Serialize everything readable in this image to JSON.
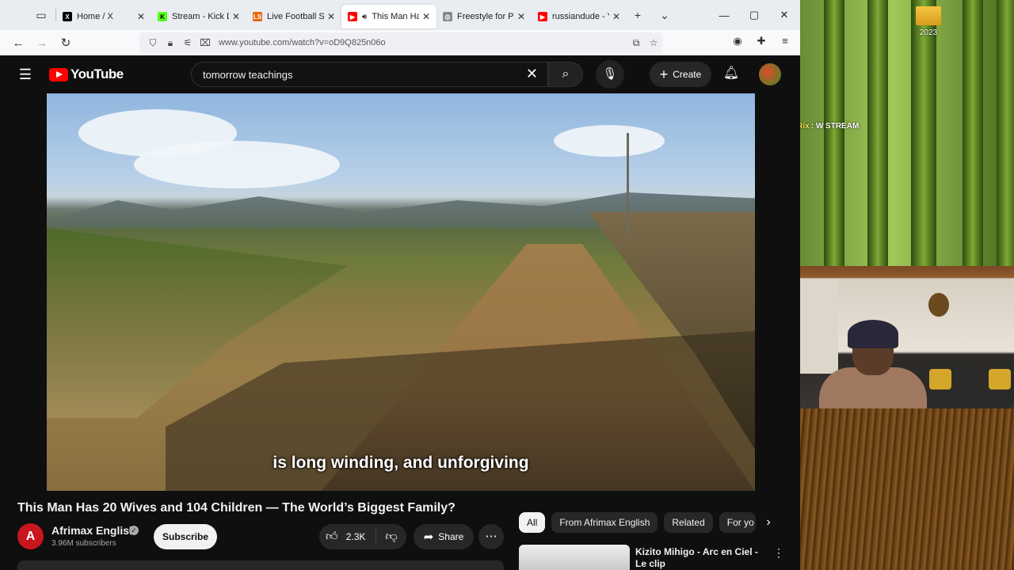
{
  "desktop": {
    "folder_label": "2023"
  },
  "chat": {
    "lines": [
      {
        "user": "",
        "text": ""
      },
      {
        "user": "",
        "text": ""
      },
      {
        "user": "",
        "text": ""
      },
      {
        "user": "BotRix",
        "text": ": W STREAM"
      }
    ]
  },
  "browser": {
    "tabs": [
      {
        "label": "Home / X",
        "fav": "X",
        "fav_color": "#000000"
      },
      {
        "label": "Stream - Kick Da",
        "fav": "K",
        "fav_color": "#53fc18"
      },
      {
        "label": "Live Football Sco",
        "fav": "LS",
        "fav_color": "#e8660c"
      },
      {
        "label": "This Man Ha",
        "fav": "▶",
        "fav_color": "#ff0000"
      },
      {
        "label": "Freestyle for Par",
        "fav": "◎",
        "fav_color": "#888888"
      },
      {
        "label": "russiandude - Yo",
        "fav": "▶",
        "fav_color": "#ff0000"
      }
    ],
    "url": "www.youtube.com/watch?v=oD9Q825n06o"
  },
  "youtube": {
    "logo_text": "YouTube",
    "search_query": "tomorrow teachings",
    "create_label": "Create",
    "caption": "is long winding, and unforgiving",
    "video_title": "This Man Has 20 Wives and 104 Children — The World’s Biggest Family?",
    "channel_initial": "A",
    "channel_name": "Afrimax English",
    "subscribers": "3.96M subscribers",
    "subscribe_label": "Subscribe",
    "like_count": "2.3K",
    "share_label": "Share",
    "chips": [
      "All",
      "From Afrimax English",
      "Related",
      "For yo"
    ],
    "recommendation_title": "Kizito Mihigo - Arc en Ciel - Le clip"
  },
  "colors": {
    "youtube_red": "#ff0000",
    "accent_bg": "#0f0f0f"
  }
}
